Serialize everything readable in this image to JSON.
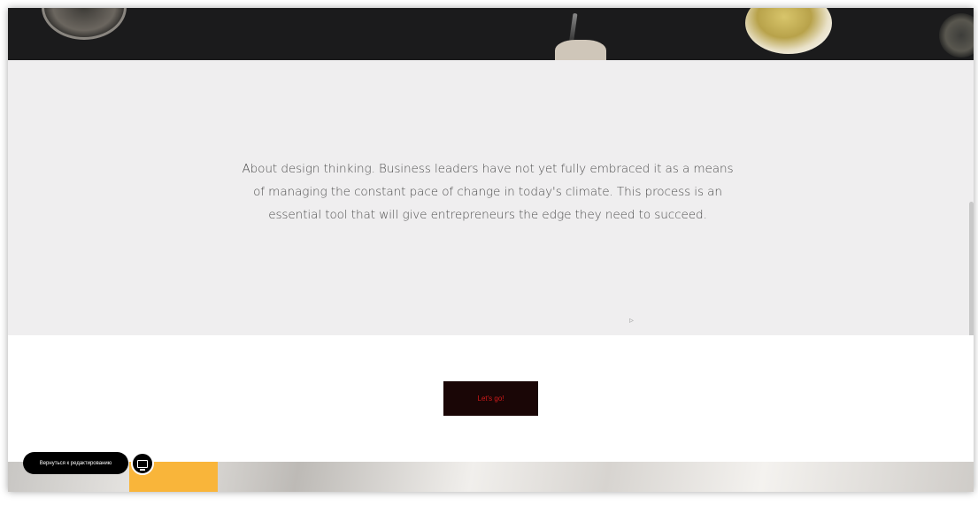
{
  "about": {
    "text": "About design thinking. Business leaders have not yet fully embraced it as a means of managing the constant pace of change in today's climate. This process is an essential tool that will give entrepreneurs the edge they need to succeed."
  },
  "cta": {
    "label": "Let's go!"
  },
  "editor": {
    "back_label": "Вернуться к редактированию",
    "preview_icon": "monitor-icon"
  },
  "colors": {
    "hero_bg": "#1b1b1c",
    "section_bg": "#efeeef",
    "button_bg": "#1a0606",
    "button_text": "#d11a1a",
    "accent_yellow": "#f9b53a"
  }
}
